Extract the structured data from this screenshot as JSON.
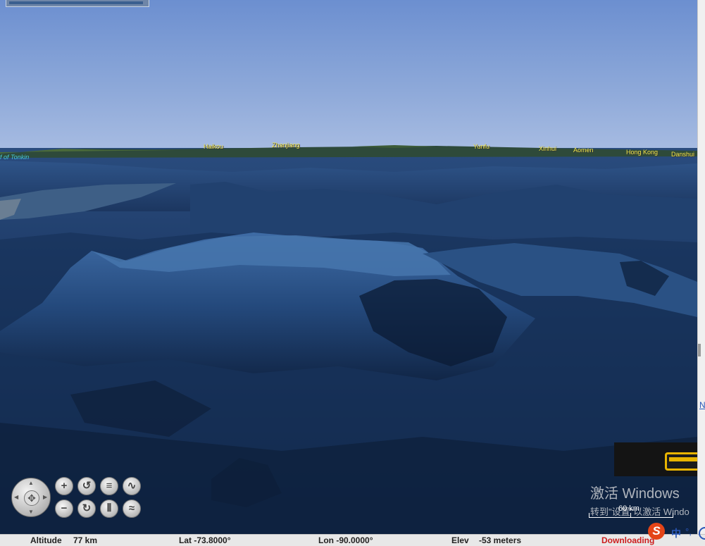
{
  "places": [
    {
      "id": "gulf",
      "label": "f of Tonkin",
      "type": "water"
    },
    {
      "id": "haikou",
      "label": "Haikou",
      "type": "city"
    },
    {
      "id": "zhanjiang",
      "label": "Zhanjiang",
      "type": "city"
    },
    {
      "id": "yunfu",
      "label": "Yunfu",
      "type": "city"
    },
    {
      "id": "xinhui",
      "label": "Xinhui",
      "type": "city"
    },
    {
      "id": "aomen",
      "label": "Aomen",
      "type": "city"
    },
    {
      "id": "hongkong",
      "label": "Hong Kong",
      "type": "city"
    },
    {
      "id": "danshui",
      "label": "Danshui",
      "type": "city"
    }
  ],
  "nav": {
    "pan_center": "✥",
    "zoom_in": "+",
    "zoom_out": "−",
    "rotate_left": "↺",
    "rotate_right": "↻",
    "tilt_up": "≡",
    "tilt_down": "⫴",
    "terrain_up": "∿",
    "terrain_down": "≈"
  },
  "scale_bar": {
    "label": "60 km"
  },
  "watermark": {
    "line1": "激活 Windows",
    "line2": "转到\"设置\"以激活 Windo"
  },
  "side_link": "N",
  "status": {
    "altitude_label": "Altitude",
    "altitude_value": "77 km",
    "lat": "Lat -73.8000°",
    "lon": "Lon -90.0000°",
    "elev_label": "Elev",
    "elev_value": "-53 meters",
    "download": "Downloading"
  },
  "ime": {
    "logo": "S",
    "mode": "中",
    "punct": "°,"
  },
  "colors": {
    "sky": "#8ea9d9",
    "ocean": "#1a3a6a",
    "place_label": "#f0e64a",
    "status_downloading": "#cc1d1d"
  },
  "icons": [
    "pan-icon",
    "zoom-in-icon",
    "zoom-out-icon",
    "rotate-left-icon",
    "rotate-right-icon",
    "tilt-up-icon",
    "tilt-down-icon",
    "terrain-up-icon",
    "terrain-down-icon",
    "sogou-ime-icon"
  ]
}
